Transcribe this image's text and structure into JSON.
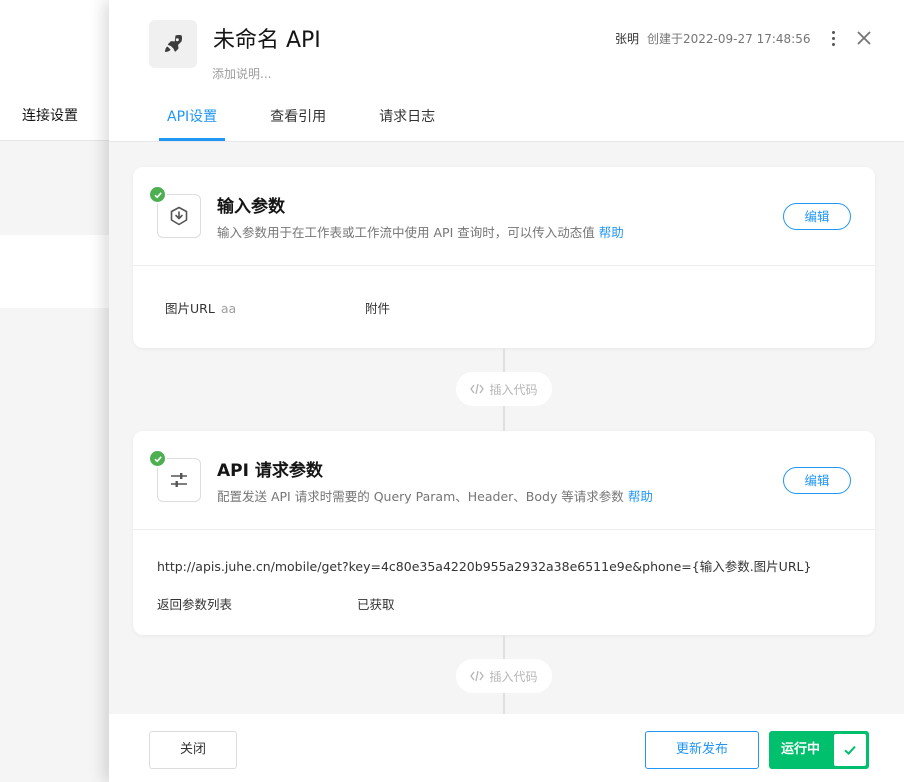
{
  "background": {
    "nav_label": "连接设置"
  },
  "header": {
    "title": "未命名 API",
    "description_placeholder": "添加说明...",
    "author": "张明",
    "created": "创建于2022-09-27 17:48:56"
  },
  "tabs": [
    {
      "label": "API设置",
      "active": true
    },
    {
      "label": "查看引用",
      "active": false
    },
    {
      "label": "请求日志",
      "active": false
    }
  ],
  "input_card": {
    "icon": "import-icon",
    "title": "输入参数",
    "subtitle": "输入参数用于在工作表或工作流中使用 API 查询时，可以传入动态值",
    "help": "帮助",
    "edit": "编辑",
    "params": [
      {
        "name": "图片URL",
        "value": "aa"
      },
      {
        "name": "附件",
        "value": ""
      }
    ]
  },
  "insert_code_label": "插入代码",
  "request_card": {
    "icon": "sliders-icon",
    "title": "API 请求参数",
    "subtitle": "配置发送 API 请求时需要的 Query Param、Header、Body 等请求参数",
    "help": "帮助",
    "edit": "编辑",
    "url": "http://apis.juhe.cn/mobile/get?key=4c80e35a4220b955a2932a38e6511e9e&phone={输入参数.图片URL}",
    "return_label": "返回参数列表",
    "return_status": "已获取"
  },
  "footer": {
    "close": "关闭",
    "publish": "更新发布",
    "running": "运行中"
  },
  "colors": {
    "accent": "#2196f3",
    "success": "#4caf50",
    "running": "#00c06d"
  }
}
